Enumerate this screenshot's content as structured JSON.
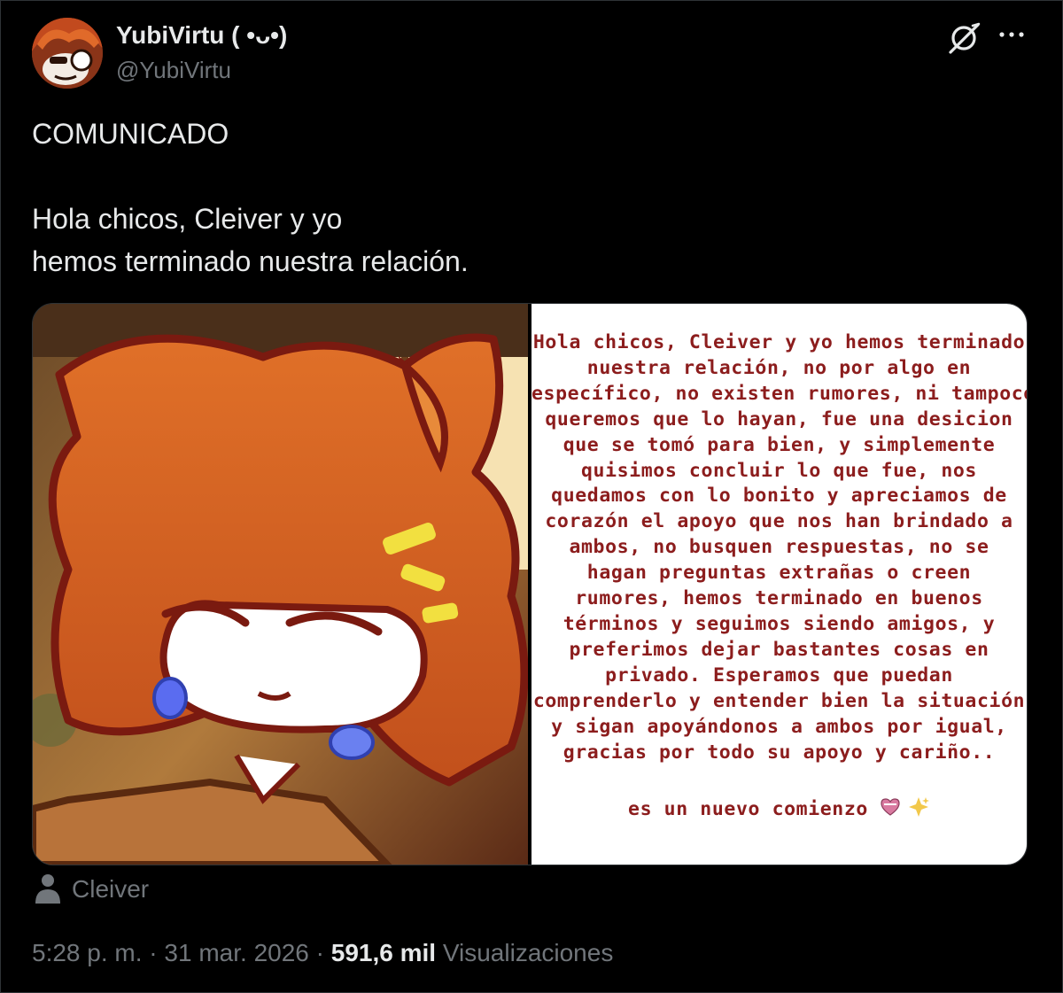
{
  "author": {
    "display_name": "YubiVirtu ( •ᴗ•)",
    "handle": "@YubiVirtu"
  },
  "actions": {
    "grok_icon": "grok-icon",
    "more_icon": "more-icon"
  },
  "tweet": {
    "line_1": "COMUNICADO",
    "line_2": "Hola chicos, Cleiver y yo",
    "line_3": "hemos terminado nuestra relación."
  },
  "media": {
    "statement_lines": [
      "Hola chicos, Cleiver y yo hemos terminado",
      "nuestra relación, no por algo en",
      "específico, no existen rumores, ni tampoco",
      "queremos que lo hayan, fue una desicion",
      "que se tomó para bien, y simplemente",
      "quisimos concluir lo que fue, nos",
      "quedamos con lo bonito y apreciamos de",
      "corazón el apoyo que nos han brindado a",
      "ambos, no busquen respuestas, no se",
      "hagan preguntas extrañas o creen",
      "rumores, hemos terminado en buenos",
      "términos y seguimos siendo amigos, y",
      "preferimos dejar bastantes cosas en",
      "privado. Esperamos que puedan",
      "comprenderlo y entender bien la situación",
      "y sigan apoyándonos a ambos por igual,",
      "gracias por todo su apoyo y cariño.."
    ],
    "tagline": "es un nuevo comienzo",
    "colors": {
      "statement_text": "#8c1d1d"
    }
  },
  "tagged": {
    "name": "Cleiver",
    "icon": "person-icon"
  },
  "meta": {
    "time": "5:28 p. m.",
    "sep": "·",
    "date": "31 mar. 2026",
    "views_count": "591,6 mil",
    "views_label": "Visualizaciones"
  }
}
